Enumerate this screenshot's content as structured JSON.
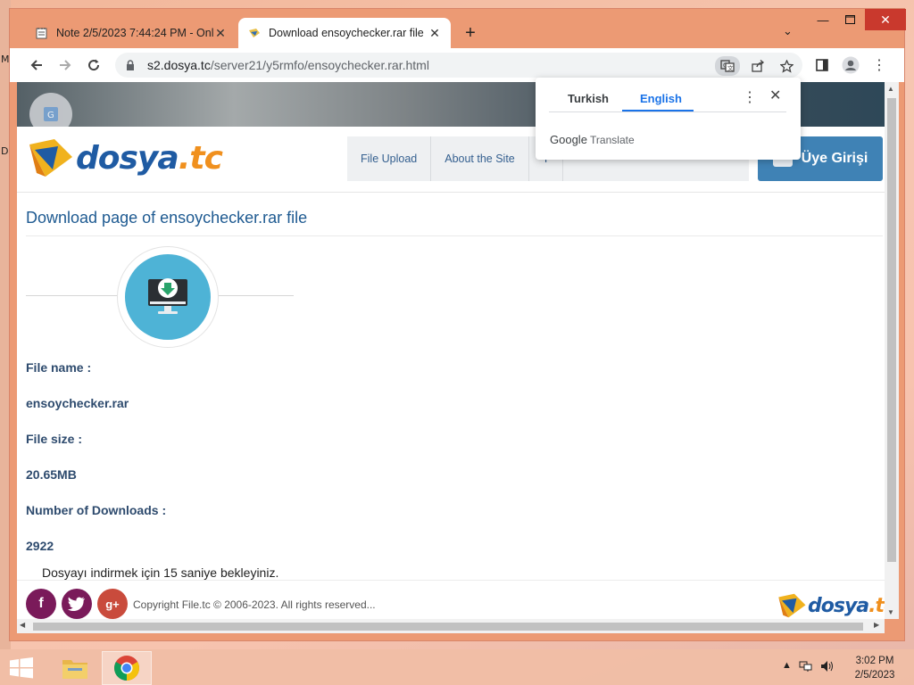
{
  "desktop": {
    "side_chars": [
      "M",
      "D"
    ]
  },
  "browser": {
    "tabs": [
      {
        "title": "Note 2/5/2023 7:44:24 PM - Onli",
        "icon": "notepad-icon",
        "active": false
      },
      {
        "title": "Download ensoychecker.rar file",
        "icon": "dosya-favicon",
        "active": true
      }
    ],
    "newtab_label": "+",
    "url_host": "s2.dosya.tc",
    "url_path": "/server21/y5rmfo/ensoychecker.rar.html"
  },
  "translate_popup": {
    "source_lang": "Turkish",
    "target_lang": "English",
    "brand_google": "Google",
    "brand_translate": "Translate"
  },
  "site": {
    "logo_main": "dosya",
    "logo_tld": ".tc",
    "nav": [
      "File Upload",
      "About the Site",
      "T"
    ],
    "login_label": "Üye Girişi",
    "page_title": "Download page of ensoychecker.rar file",
    "fields": {
      "file_name_label": "File name :",
      "file_name_value": "ensoychecker.rar",
      "file_size_label": "File size :",
      "file_size_value": "20.65MB",
      "downloads_label": "Number of Downloads :",
      "downloads_value": "2922"
    },
    "wait_text": "Dosyayı indirmek için 15 saniye bekleyiniz.",
    "copyright": "Copyright File.tc © 2006-2023. All rights reserved...",
    "social": [
      "f",
      "t",
      "g+"
    ]
  },
  "taskbar": {
    "time": "3:02 PM",
    "date": "2/5/2023"
  },
  "colors": {
    "accent_blue": "#1e5a91",
    "login_blue": "#3f82b5",
    "download_circle": "#4eb3d6",
    "facebook": "#7a1a5a",
    "twitter": "#7a1a5a",
    "gplus": "#c94b3c"
  }
}
